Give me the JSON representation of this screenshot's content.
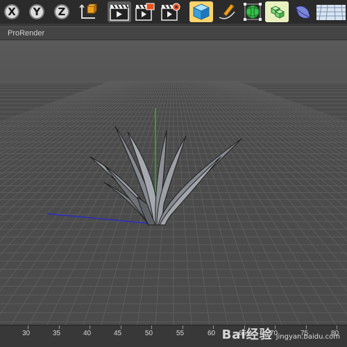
{
  "toolbar": {
    "axis_buttons": [
      "X",
      "Y",
      "Z"
    ],
    "icons": [
      "world-coordinates-icon",
      "render-view-icon",
      "render-to-picture-viewer-icon",
      "render-settings-icon",
      "cube-primitive-icon",
      "pen-spline-icon",
      "subdivision-surface-icon",
      "array-generator-icon",
      "deformer-icon",
      "floor-environment-icon"
    ]
  },
  "viewport": {
    "tab_label": "ProRender",
    "background_color": "#4b4b4b",
    "grid_color": "#5d5d5d",
    "y_axis_color": "#22c322",
    "x_axis_color": "#2a2acc",
    "object_name": "grass-clump"
  },
  "timeline": {
    "ticks": [
      "30",
      "35",
      "40",
      "45",
      "50",
      "55",
      "60",
      "65",
      "70",
      "75",
      "80"
    ]
  },
  "watermark": {
    "brand": "Bai经验",
    "sub": "jingyan.baidu.com"
  }
}
